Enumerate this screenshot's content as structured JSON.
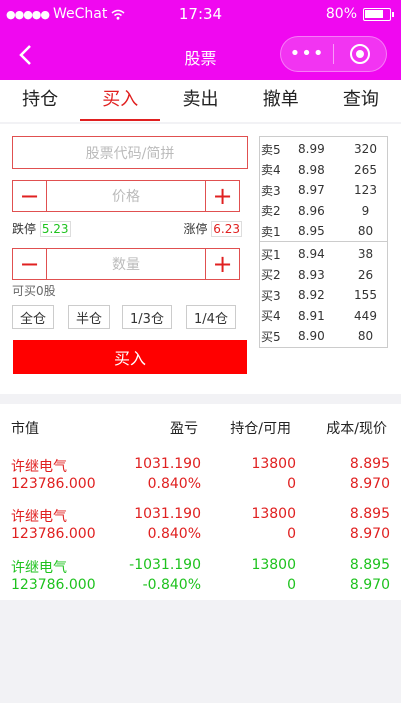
{
  "status_bar": {
    "carrier": "WeChat",
    "time": "17:34",
    "battery": "80%"
  },
  "header": {
    "title": "股票",
    "more_label": "•••"
  },
  "tabs": [
    {
      "label": "持仓",
      "active": false
    },
    {
      "label": "买入",
      "active": true
    },
    {
      "label": "卖出",
      "active": false
    },
    {
      "label": "撤单",
      "active": false
    },
    {
      "label": "查询",
      "active": false
    }
  ],
  "trade_form": {
    "code_placeholder": "股票代码/简拼",
    "price_placeholder": "价格",
    "quantity_placeholder": "数量",
    "minus": "−",
    "plus": "+",
    "limit_down_label": "跌停",
    "limit_down_value": "5.23",
    "limit_up_label": "涨停",
    "limit_up_value": "6.23",
    "can_buy": "可买0股",
    "ratios": [
      "全仓",
      "半仓",
      "1/3仓",
      "1/4仓"
    ],
    "buy_label": "买入"
  },
  "orderbook": {
    "sell": [
      {
        "label": "卖5",
        "price": "8.99",
        "volume": "320"
      },
      {
        "label": "卖4",
        "price": "8.98",
        "volume": "265"
      },
      {
        "label": "卖3",
        "price": "8.97",
        "volume": "123"
      },
      {
        "label": "卖2",
        "price": "8.96",
        "volume": "9"
      },
      {
        "label": "卖1",
        "price": "8.95",
        "volume": "80"
      }
    ],
    "buy": [
      {
        "label": "买1",
        "price": "8.94",
        "volume": "38"
      },
      {
        "label": "买2",
        "price": "8.93",
        "volume": "26"
      },
      {
        "label": "买3",
        "price": "8.92",
        "volume": "155"
      },
      {
        "label": "买4",
        "price": "8.91",
        "volume": "449"
      },
      {
        "label": "买5",
        "price": "8.90",
        "volume": "80"
      }
    ]
  },
  "positions": {
    "headers": {
      "market_value": "市值",
      "pnl": "盈亏",
      "holding": "持仓/可用",
      "cost": "成本/现价"
    },
    "rows": [
      {
        "name": "许继电气",
        "market_value": "123786.000",
        "pnl": "1031.190",
        "pnl_pct": "0.840%",
        "holding": "13800",
        "available": "0",
        "cost": "8.895",
        "price": "8.970",
        "color": "#e02020"
      },
      {
        "name": "许继电气",
        "market_value": "123786.000",
        "pnl": "1031.190",
        "pnl_pct": "0.840%",
        "holding": "13800",
        "available": "0",
        "cost": "8.895",
        "price": "8.970",
        "color": "#e02020"
      },
      {
        "name": "许继电气",
        "market_value": "123786.000",
        "pnl": "-1031.190",
        "pnl_pct": "-0.840%",
        "holding": "13800",
        "available": "0",
        "cost": "8.895",
        "price": "8.970",
        "color": "#1ec21e"
      }
    ]
  },
  "colors": {
    "brand": "#f008f0",
    "accent_red": "#e02020",
    "buy_button": "#ff0000",
    "green": "#1ec21e"
  }
}
